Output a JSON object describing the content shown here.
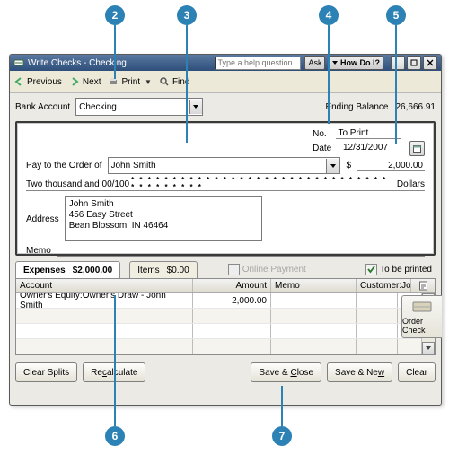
{
  "callouts": {
    "c2": "2",
    "c3": "3",
    "c4": "4",
    "c5": "5",
    "c6": "6",
    "c7": "7"
  },
  "title": "Write Checks - Checking",
  "help_placeholder": "Type a help question",
  "title_buttons": {
    "ask": "Ask",
    "howdoi": "How Do I?"
  },
  "toolbar": {
    "previous": "Previous",
    "next": "Next",
    "print": "Print",
    "find": "Find"
  },
  "bank": {
    "label": "Bank Account",
    "value": "Checking"
  },
  "ending": {
    "label": "Ending Balance",
    "value": "26,666.91"
  },
  "check": {
    "no_label": "No.",
    "no_value": "To Print",
    "date_label": "Date",
    "date_value": "12/31/2007",
    "pay_label": "Pay to the Order of",
    "payee": "John Smith",
    "currency": "$",
    "amount": "2,000.00",
    "words": "Two thousand  and 00/100",
    "dollars_label": "Dollars",
    "addr_label": "Address",
    "addr_line1": "John Smith",
    "addr_line2": "456 Easy Street",
    "addr_line3": "Bean Blossom, IN 46464",
    "memo_label": "Memo"
  },
  "order_check": "Order Check",
  "tabs": {
    "expenses_label": "Expenses",
    "expenses_amount": "$2,000.00",
    "items_label": "Items",
    "items_amount": "$0.00",
    "online_label": "Online Payment",
    "tobe_printed": "To be printed"
  },
  "grid": {
    "h_account": "Account",
    "h_amount": "Amount",
    "h_memo": "Memo",
    "h_customer": "Customer:Job",
    "row_account": "Owner's Equity:Owner's Draw - John Smith",
    "row_amount": "2,000.00"
  },
  "buttons": {
    "clear_splits": "Clear Splits",
    "recalculate": "Recalculate",
    "save_close_pre": "Save & ",
    "save_close_u": "C",
    "save_close_post": "lose",
    "save_new_pre": "Save & Ne",
    "save_new_u": "w",
    "save_new_post": "",
    "clear": "Clear"
  }
}
